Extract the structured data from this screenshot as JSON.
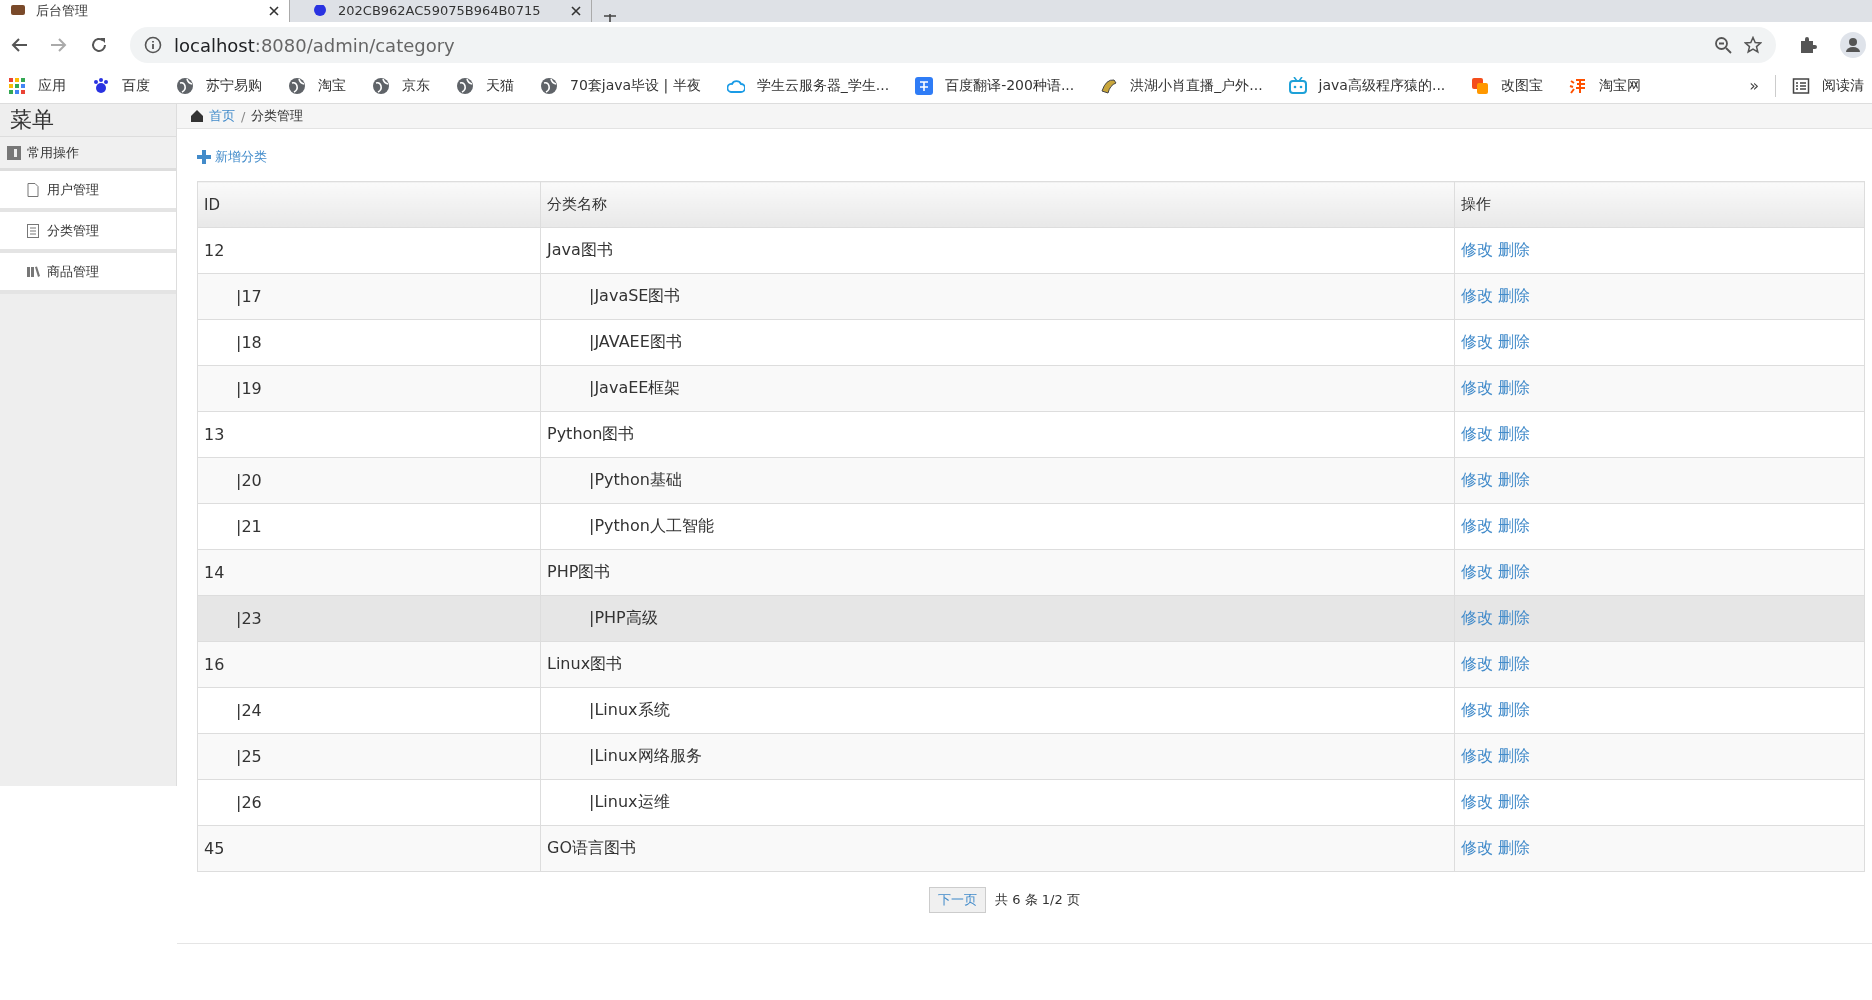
{
  "browser": {
    "tabs": [
      {
        "title": "后台管理",
        "selected": true
      },
      {
        "title": "202CB962AC59075B964B0715",
        "selected": false
      }
    ],
    "address": {
      "host": "localhost",
      "rest": ":8080/admin/category"
    },
    "bookmarks": [
      {
        "label": "应用"
      },
      {
        "label": "百度"
      },
      {
        "label": "苏宁易购"
      },
      {
        "label": "淘宝"
      },
      {
        "label": "京东"
      },
      {
        "label": "天猫"
      },
      {
        "label": "70套java毕设 | 半夜"
      },
      {
        "label": "学生云服务器_学生..."
      },
      {
        "label": "百度翻译-200种语..."
      },
      {
        "label": "洪湖小肖直播_户外..."
      },
      {
        "label": "java高级程序猿的..."
      },
      {
        "label": "改图宝"
      },
      {
        "label": "淘宝网"
      }
    ],
    "more": "»",
    "reading_list": "阅读清"
  },
  "sidebar": {
    "title": "菜单",
    "section": "常用操作",
    "items": [
      {
        "label": "用户管理"
      },
      {
        "label": "分类管理"
      },
      {
        "label": "商品管理"
      }
    ]
  },
  "breadcrumb": {
    "home": "首页",
    "separator": "/",
    "current": "分类管理"
  },
  "add_button": "新增分类",
  "table": {
    "columns": [
      "ID",
      "分类名称",
      "操作"
    ],
    "rows": [
      {
        "kind": "parent",
        "id": "12",
        "name": "Java图书",
        "hovered": false,
        "actions": [
          "修改",
          "删除"
        ]
      },
      {
        "kind": "child",
        "id": "|17",
        "name": "|JavaSE图书",
        "hovered": false,
        "actions": [
          "修改",
          "删除"
        ]
      },
      {
        "kind": "child",
        "id": "|18",
        "name": "|JAVAEE图书",
        "hovered": false,
        "actions": [
          "修改",
          "删除"
        ]
      },
      {
        "kind": "child",
        "id": "|19",
        "name": "|JavaEE框架",
        "hovered": false,
        "actions": [
          "修改",
          "删除"
        ]
      },
      {
        "kind": "parent",
        "id": "13",
        "name": "Python图书",
        "hovered": false,
        "actions": [
          "修改",
          "删除"
        ]
      },
      {
        "kind": "child",
        "id": "|20",
        "name": "|Python基础",
        "hovered": false,
        "actions": [
          "修改",
          "删除"
        ]
      },
      {
        "kind": "child",
        "id": "|21",
        "name": "|Python人工智能",
        "hovered": false,
        "actions": [
          "修改",
          "删除"
        ]
      },
      {
        "kind": "parent",
        "id": "14",
        "name": "PHP图书",
        "hovered": false,
        "actions": [
          "修改",
          "删除"
        ]
      },
      {
        "kind": "child",
        "id": "|23",
        "name": "|PHP高级",
        "hovered": true,
        "actions": [
          "修改",
          "删除"
        ]
      },
      {
        "kind": "parent",
        "id": "16",
        "name": "Linux图书",
        "hovered": false,
        "actions": [
          "修改",
          "删除"
        ]
      },
      {
        "kind": "child",
        "id": "|24",
        "name": "|Linux系统",
        "hovered": false,
        "actions": [
          "修改",
          "删除"
        ]
      },
      {
        "kind": "child",
        "id": "|25",
        "name": "|Linux网络服务",
        "hovered": false,
        "actions": [
          "修改",
          "删除"
        ]
      },
      {
        "kind": "child",
        "id": "|26",
        "name": "|Linux运维",
        "hovered": false,
        "actions": [
          "修改",
          "删除"
        ]
      },
      {
        "kind": "parent",
        "id": "45",
        "name": "GO语言图书",
        "hovered": false,
        "actions": [
          "修改",
          "删除"
        ]
      }
    ]
  },
  "pagination": {
    "next": "下一页",
    "summary": "共 6 条 1/2 页"
  }
}
